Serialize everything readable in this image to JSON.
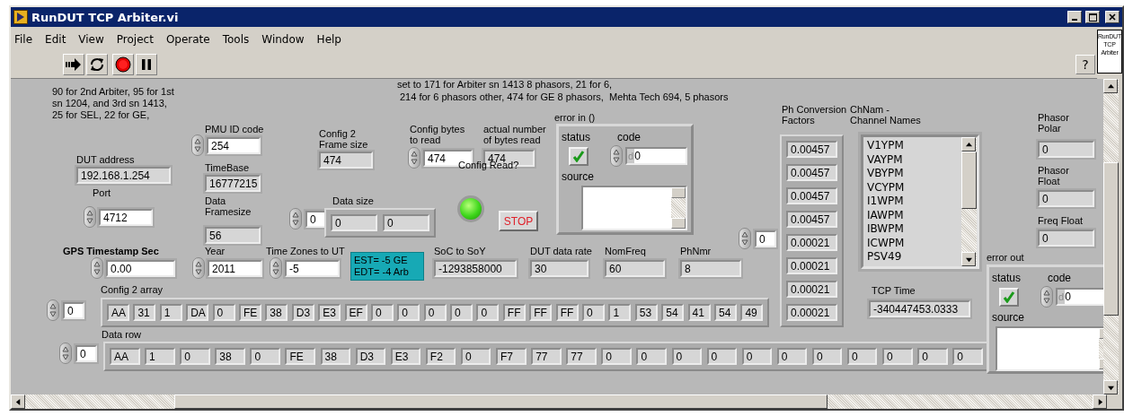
{
  "window": {
    "title": "RunDUT TCP Arbiter.vi"
  },
  "menu": [
    "File",
    "Edit",
    "View",
    "Project",
    "Operate",
    "Tools",
    "Window",
    "Help"
  ],
  "vi_icon": "RunDUT\nTCP\nArbiter",
  "help_button": "?",
  "notes": [
    {
      "kind": "plain",
      "text": "90 for 2nd Arbiter, 95 for 1st\nsn 1204, and 3rd sn 1413,\n25 for SEL, 22 for GE,"
    },
    {
      "kind": "plain",
      "text": "set to 171 for Arbiter sn 1413 8 phasors, 21 for 6,"
    },
    {
      "kind": "plain",
      "text": "214 for 6 phasors other, 474 for GE 8 phasors,  Mehta Tech 694, 5 phasors"
    },
    {
      "kind": "highlight",
      "text": "EST= -5 GE\nEDT= -4 Arb"
    }
  ],
  "controls": [
    {
      "kind": "indicator",
      "label": "DUT address",
      "value": "192.168.1.254"
    },
    {
      "kind": "numeric_control",
      "label": "Port",
      "value": "4712"
    },
    {
      "kind": "numeric_control",
      "label": "GPS Timestamp Sec",
      "value": "0.00"
    },
    {
      "kind": "numeric_control",
      "label": "PMU ID code",
      "value": "254"
    },
    {
      "kind": "indicator",
      "label": "TimeBase",
      "value": "16777215"
    },
    {
      "kind": "indicator",
      "label": "Data\nFramesize",
      "value": "56"
    },
    {
      "kind": "numeric_control",
      "label": "Year",
      "value": "2011"
    },
    {
      "kind": "indicator",
      "label": "Config 2\nFrame size",
      "value": "474"
    },
    {
      "kind": "array",
      "label": "Data size",
      "index": "0",
      "elements": [
        "0",
        "0"
      ]
    },
    {
      "kind": "numeric_control",
      "label": "Time Zones to UT",
      "value": "-5"
    },
    {
      "kind": "numeric_control",
      "label": "Config bytes\nto read",
      "value": "474"
    },
    {
      "kind": "indicator",
      "label": "actual number\nof bytes read",
      "value": "474"
    },
    {
      "kind": "led",
      "label": "Config Read?",
      "on": true
    },
    {
      "kind": "button",
      "label": "STOP"
    },
    {
      "kind": "indicator",
      "label": "SoC to SoY",
      "value": "-1293858000"
    },
    {
      "kind": "error_cluster",
      "label": "error in ()",
      "status_label": "status",
      "code_label": "code",
      "source_label": "source",
      "status": false,
      "radix": "d",
      "code": "0"
    },
    {
      "kind": "indicator",
      "label": "DUT data rate",
      "value": "30"
    },
    {
      "kind": "indicator",
      "label": "NomFreq",
      "value": "60"
    },
    {
      "kind": "indicator",
      "label": "PhNmr",
      "value": "8"
    },
    {
      "kind": "array",
      "label": "Config 2 array",
      "index": "0",
      "elements": [
        "AA",
        "31",
        "1",
        "DA",
        "0",
        "FE",
        "38",
        "D3",
        "E3",
        "EF",
        "0",
        "0",
        "0",
        "0",
        "0",
        "FF",
        "FF",
        "FF",
        "0",
        "1",
        "53",
        "54",
        "41",
        "54",
        "49"
      ]
    },
    {
      "kind": "array",
      "label": "Ph Conversion\nFactors",
      "index": "0",
      "elements": [
        "0.00457",
        "0.00457",
        "0.00457",
        "0.00457",
        "0.00021",
        "0.00021",
        "0.00021",
        "0.00021"
      ]
    },
    {
      "kind": "listbox",
      "label": "ChNam -\nChannel Names",
      "items": [
        "V1YPM",
        "VAYPM",
        "VBYPM",
        "VCYPM",
        "I1WPM",
        "IAWPM",
        "IBWPM",
        "ICWPM",
        "PSV49"
      ]
    },
    {
      "kind": "indicator",
      "label": "TCP Time",
      "value": "-340447453.0333"
    },
    {
      "kind": "array",
      "label": "Data row",
      "index": "0",
      "elements": [
        "AA",
        "1",
        "0",
        "38",
        "0",
        "FE",
        "38",
        "D3",
        "E3",
        "F2",
        "0",
        "F7",
        "77",
        "77",
        "0",
        "0",
        "0",
        "0",
        "0",
        "0",
        "0",
        "0",
        "0",
        "0",
        "0"
      ]
    },
    {
      "kind": "indicator",
      "label": "Phasor\nPolar",
      "value": "0"
    },
    {
      "kind": "indicator",
      "label": "Phasor\nFloat",
      "value": "0"
    },
    {
      "kind": "indicator",
      "label": "Freq Float",
      "value": "0"
    },
    {
      "kind": "error_cluster",
      "label": "error out",
      "status_label": "status",
      "code_label": "code",
      "source_label": "source",
      "status": false,
      "radix": "d",
      "code": "0"
    }
  ]
}
